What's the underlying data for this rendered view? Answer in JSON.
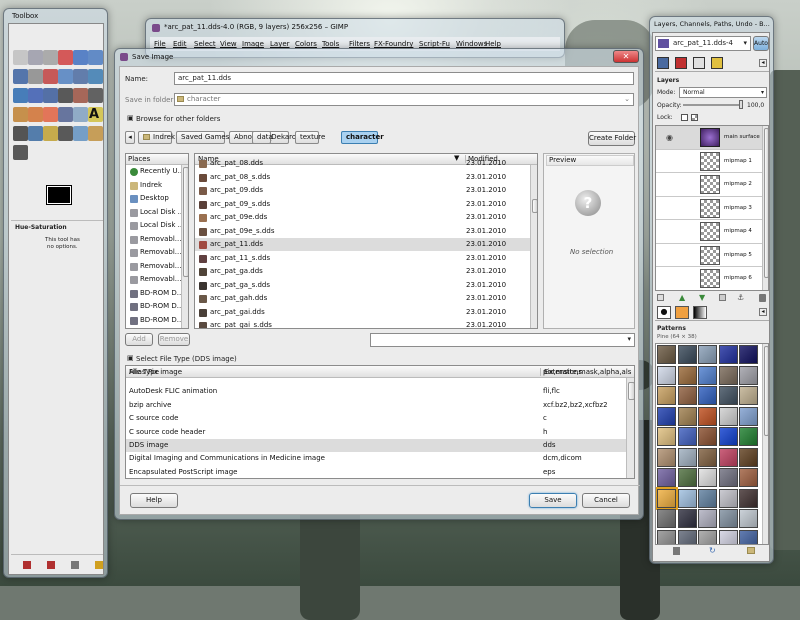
{
  "toolbox": {
    "title": "Toolbox",
    "panel_title": "Hue-Saturation",
    "panel_msg1": "This tool has",
    "panel_msg2": "no options."
  },
  "gimp_window": {
    "title": "*arc_pat_11.dds-4.0 (RGB, 9 layers) 256x256 – GIMP",
    "menus": [
      "File",
      "Edit",
      "Select",
      "View",
      "Image",
      "Layer",
      "Colors",
      "Tools",
      "Filters",
      "FX-Foundry",
      "Script-Fu",
      "Windows",
      "Help"
    ]
  },
  "dialog": {
    "title": "Save Image",
    "name_label": "Name:",
    "name_value": "arc_pat_11.dds",
    "folder_label": "Save in folder:",
    "folder_value": "character",
    "browse_label": "Browse for other folders",
    "breadcrumbs": [
      "Indrek",
      "Saved Games",
      "Abnormal_Dekaron",
      "data",
      "texture",
      "character"
    ],
    "create_folder": "Create Folder",
    "places_header": "Places",
    "places": [
      "Recently U...",
      "Indrek",
      "Desktop",
      "Local Disk ...",
      "Local Disk ...",
      "Removabl...",
      "Removabl...",
      "Removabl...",
      "Removabl...",
      "BD-ROM D...",
      "BD-ROM D...",
      "BD-ROM D..."
    ],
    "add_label": "Add",
    "remove_label": "Remove",
    "col_name": "Name",
    "col_modified": "Modified",
    "files": [
      {
        "name": "arc_pat_08.dds",
        "date": "23.01.2010",
        "icon": "#8a6a50",
        "partial": true
      },
      {
        "name": "arc_pat_08_s.dds",
        "date": "23.01.2010",
        "icon": "#6a4a3a"
      },
      {
        "name": "arc_pat_09.dds",
        "date": "23.01.2010",
        "icon": "#7a5a48"
      },
      {
        "name": "arc_pat_09_s.dds",
        "date": "23.01.2010",
        "icon": "#5a4038"
      },
      {
        "name": "arc_pat_09e.dds",
        "date": "23.01.2010",
        "icon": "#9a7050"
      },
      {
        "name": "arc_pat_09e_s.dds",
        "date": "23.01.2010",
        "icon": "#6a5040"
      },
      {
        "name": "arc_pat_11.dds",
        "date": "23.01.2010",
        "icon": "#a04a40",
        "selected": true
      },
      {
        "name": "arc_pat_11_s.dds",
        "date": "23.01.2010",
        "icon": "#604040"
      },
      {
        "name": "arc_pat_ga.dds",
        "date": "23.01.2010",
        "icon": "#504438"
      },
      {
        "name": "arc_pat_ga_s.dds",
        "date": "23.01.2010",
        "icon": "#3a3430"
      },
      {
        "name": "arc_pat_gah.dds",
        "date": "23.01.2010",
        "icon": "#6a5848"
      },
      {
        "name": "arc_pat_gai.dds",
        "date": "23.01.2010",
        "icon": "#4a4038"
      },
      {
        "name": "arc_pat_gai_s.dds",
        "date": "23.01.2010",
        "icon": "#5a4a40",
        "partial": true
      }
    ],
    "preview_label": "Preview",
    "no_selection": "No selection",
    "filetype_label": "Select File Type (DDS image)",
    "ft_col_type": "File Type",
    "ft_col_ext": "Extensions",
    "filetypes": [
      {
        "type": "Alias Pix image",
        "ext": "pix,matte,mask,alpha,als"
      },
      {
        "type": "AutoDesk FLIC animation",
        "ext": "fli,flc"
      },
      {
        "type": "bzip archive",
        "ext": "xcf.bz2,bz2,xcfbz2"
      },
      {
        "type": "C source code",
        "ext": "c"
      },
      {
        "type": "C source code header",
        "ext": "h"
      },
      {
        "type": "DDS image",
        "ext": "dds",
        "selected": true
      },
      {
        "type": "Digital Imaging and Communications in Medicine image",
        "ext": "dcm,dicom"
      },
      {
        "type": "Encapsulated PostScript image",
        "ext": "eps"
      }
    ],
    "help": "Help",
    "save": "Save",
    "cancel": "Cancel"
  },
  "dock": {
    "title": "Layers, Channels, Paths, Undo - B...",
    "image_select": "arc_pat_11.dds-4",
    "auto": "Auto",
    "layers_header": "Layers",
    "mode_label": "Mode:",
    "mode_value": "Normal",
    "opacity_label": "Opacity:",
    "opacity_value": "100,0",
    "lock_label": "Lock:",
    "layers": [
      {
        "name": "main surface",
        "main": true
      },
      {
        "name": "mipmap 1"
      },
      {
        "name": "mipmap 2"
      },
      {
        "name": "mipmap 3"
      },
      {
        "name": "mipmap 4"
      },
      {
        "name": "mipmap 5"
      },
      {
        "name": "mipmap 6"
      }
    ],
    "patterns_header": "Patterns",
    "pattern_name": "Pine (64 × 38)",
    "patterns": [
      "#6b5a43",
      "#3a4a5a",
      "#8aa0b8",
      "#2030a0",
      "#101060",
      "#d0d8e8",
      "#9a6a3a",
      "#5080d0",
      "#7a6a5a",
      "#a0a0a8",
      "#c8a060",
      "#906040",
      "#3060c0",
      "#405060",
      "#c0b090",
      "#2040b0",
      "#a08050",
      "#c05020",
      "#d0d0d0",
      "#80a0d0",
      "#e0c080",
      "#4060c0",
      "#8a5030",
      "#1040d0",
      "#208030",
      "#b09070",
      "#a0b0c0",
      "#806040",
      "#c04060",
      "#604020",
      "#7060a0",
      "#507040",
      "#e0e0e0",
      "#707080",
      "#a06040",
      "#f0b040",
      "#a0c0e0",
      "#6080a0",
      "#c0c0c8",
      "#403030",
      "#707070",
      "#303040",
      "#b0b0c0",
      "#8090a0",
      "#c0c8d0",
      "#909090",
      "#606878",
      "#a0a0a0",
      "#d0d0e0",
      "#4060a0"
    ]
  },
  "colors": {
    "accent": "#3c7fb1",
    "selected_crumb": "#a9d1f0",
    "selection": "#dcdcdc"
  }
}
